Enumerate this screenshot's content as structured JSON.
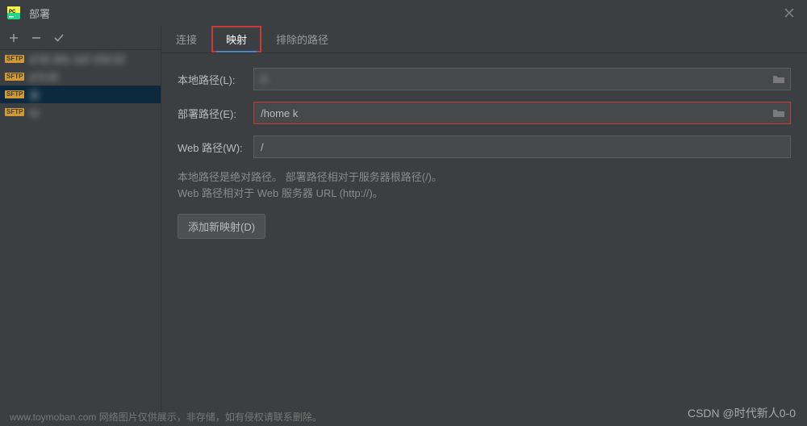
{
  "titlebar": {
    "title": "部署"
  },
  "sidebar": {
    "items": [
      {
        "label": "d       52.201 110 153:22"
      },
      {
        "label": "d                         5:22"
      },
      {
        "label": "实"
      },
      {
        "label": "ro"
      }
    ]
  },
  "tabs": {
    "connection": "连接",
    "mapping": "映射",
    "excluded": "排除的路径"
  },
  "form": {
    "local_path_label": "本地路径(L):",
    "local_path_value": "C                                                                                   ",
    "deploy_path_label": "部署路径(E):",
    "deploy_path_value": "/home           k",
    "web_path_label": "Web 路径(W):",
    "web_path_value": "/",
    "help_line1": "本地路径是绝对路径。 部署路径相对于服务器根路径(/)。",
    "help_line2": "Web 路径相对于 Web 服务器 URL (http://)。",
    "add_mapping": "添加新映射(D)"
  },
  "watermark": {
    "left": "www.toymoban.com 网络图片仅供展示，非存储，如有侵权请联系删除。",
    "right": "CSDN @时代新人0-0"
  }
}
